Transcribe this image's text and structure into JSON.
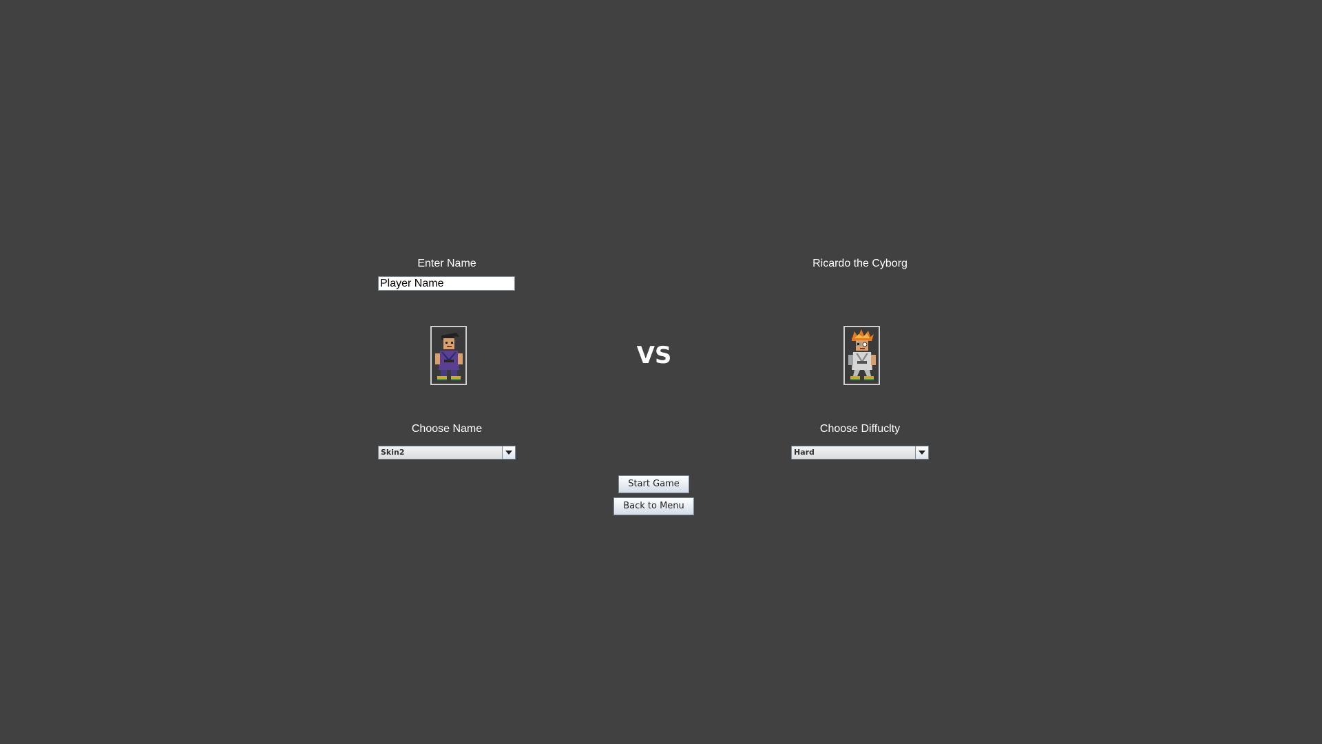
{
  "player": {
    "enter_name_label": "Enter Name",
    "name_value": "Player Name",
    "choose_label": "Choose Name",
    "skin_selected": "Skin2"
  },
  "opponent": {
    "name": "Ricardo the Cyborg",
    "choose_label": "Choose Diffuclty",
    "difficulty_selected": "Hard"
  },
  "vs_text": "VS",
  "buttons": {
    "start": "Start Game",
    "back": "Back to Menu"
  },
  "colors": {
    "background": "#414141",
    "text": "#ffffff"
  },
  "icons": {
    "player_portrait": "ninja-fighter-sprite",
    "opponent_portrait": "cyborg-fighter-sprite",
    "combo_arrow": "chevron-down-icon"
  }
}
